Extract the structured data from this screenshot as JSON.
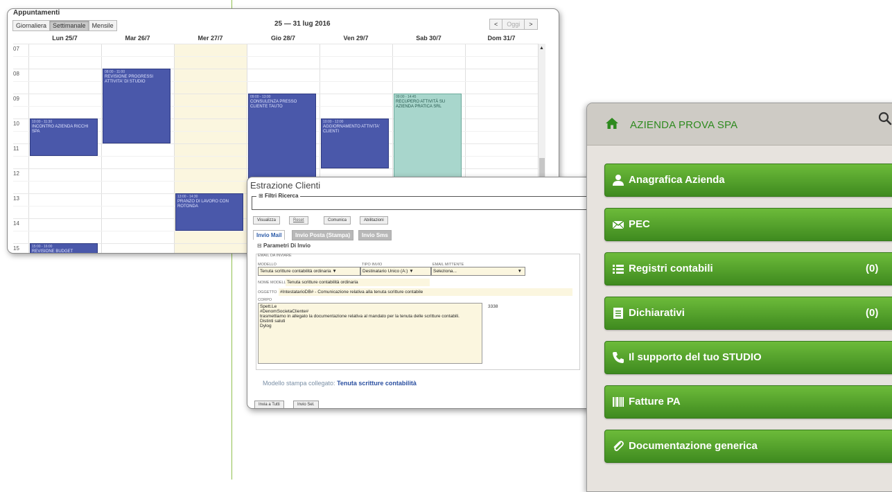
{
  "calendar": {
    "title": "Appuntamenti",
    "view_buttons": [
      "Giornaliera",
      "Settimanale",
      "Mensile"
    ],
    "active_view": "Settimanale",
    "date_range": "25 — 31 lug 2016",
    "nav": {
      "prev": "<",
      "today": "Oggi",
      "next": ">"
    },
    "days": [
      "Lun 25/7",
      "Mar 26/7",
      "Mer 27/7",
      "Gio 28/7",
      "Ven 29/7",
      "Sab 30/7",
      "Dom 31/7"
    ],
    "hours": [
      "07",
      "08",
      "09",
      "10",
      "11",
      "12",
      "13",
      "14",
      "15"
    ],
    "events": [
      {
        "day": 0,
        "start": 10.0,
        "end": 11.5,
        "time": "10:00 - 11:30",
        "title": "INCONTRO AZIENDA RICCHI SPA",
        "color": "blue"
      },
      {
        "day": 1,
        "start": 8.0,
        "end": 11.0,
        "time": "08:00 - 11:00",
        "title": "REVISIONE PROGRESSI ATTIVITA' DI STUDIO",
        "color": "blue"
      },
      {
        "day": 3,
        "start": 9.0,
        "end": 13.0,
        "time": "09:00 - 13:00",
        "title": "CONSULENZA PRESSO CLIENTE TAUTO",
        "color": "blue"
      },
      {
        "day": 4,
        "start": 10.0,
        "end": 12.0,
        "time": "10:00 - 12:00",
        "title": "AGGIORNAMENTO ATTIVITA' CLIENTI",
        "color": "blue"
      },
      {
        "day": 5,
        "start": 9.0,
        "end": 14.0,
        "time": "09:00 - 14:45",
        "title": "RECUPERO ATTIVITÀ SU AZIENDA PRATICA SRL",
        "color": "green"
      },
      {
        "day": 2,
        "start": 13.0,
        "end": 14.5,
        "time": "13:00 - 14:30",
        "title": "PRANZO DI LAVORO CON ROTONDA",
        "color": "blue"
      },
      {
        "day": 0,
        "start": 15.0,
        "end": 15.6,
        "time": "15:00 - 16:00",
        "title": "REVISIONE BUDGET",
        "color": "blue"
      }
    ]
  },
  "estrazione": {
    "title": "Estrazione Clienti",
    "filtri_label": "Filtri Ricerca",
    "toolbar": [
      "Visualizza",
      "Reset",
      "Comunica",
      "Abilitazioni"
    ],
    "tabs": [
      "Invio Mail",
      "Invio Posta (Stampa)",
      "Invio Sms"
    ],
    "section": "Parametri Di Invio",
    "email_legend": "EMAIL DA INVIARE",
    "modello_label": "MODELLO",
    "modello_value": "Tenuta scritture contabilità ordinaria ▼",
    "tipo_label": "TIPO INVIO",
    "tipo_value": "Destinatario Unico (A:) ▼",
    "mittente_label": "EMAIL MITTENTE",
    "mittente_value": "Seleziona...",
    "nome_modello_label": "NOME MODELLO",
    "nome_modello_value": "Tenuta scritture contabilità ordinaria",
    "oggetto_label": "OGGETTO",
    "oggetto_value": "#IntestatarioDB# - Comunicazione relativa alla tenuta scritture contabile",
    "corpo_label": "CORPO",
    "corpo_text": "Spett.Le\n#DenomSocietaCliente#\ntrasmettiamo in allegato la documentazione relativa al mandato per la tenuta delle scritture contabili.\nDistinti saluti\nDylog",
    "char_count": "3338",
    "modello_stampa_label": "Modello stampa collegato:",
    "modello_stampa_value": "Tenuta scritture contabilità",
    "bottom_buttons": [
      "Invia a Tutti",
      "Invio Sel."
    ]
  },
  "azienda": {
    "name": "AZIENDA PROVA SPA",
    "menu": [
      {
        "label": "Anagrafica Azienda",
        "icon": "user-icon",
        "count": ""
      },
      {
        "label": "PEC",
        "icon": "envelope-icon",
        "count": ""
      },
      {
        "label": "Registri contabili",
        "icon": "list-icon",
        "count": "(0)"
      },
      {
        "label": "Dichiarativi",
        "icon": "document-icon",
        "count": "(0)"
      },
      {
        "label": "Il supporto del tuo STUDIO",
        "icon": "phone-icon",
        "count": ""
      },
      {
        "label": "Fatture PA",
        "icon": "barcode-icon",
        "count": ""
      },
      {
        "label": "Documentazione generica",
        "icon": "paperclip-icon",
        "count": ""
      }
    ],
    "accent": "#2e8a1f"
  }
}
